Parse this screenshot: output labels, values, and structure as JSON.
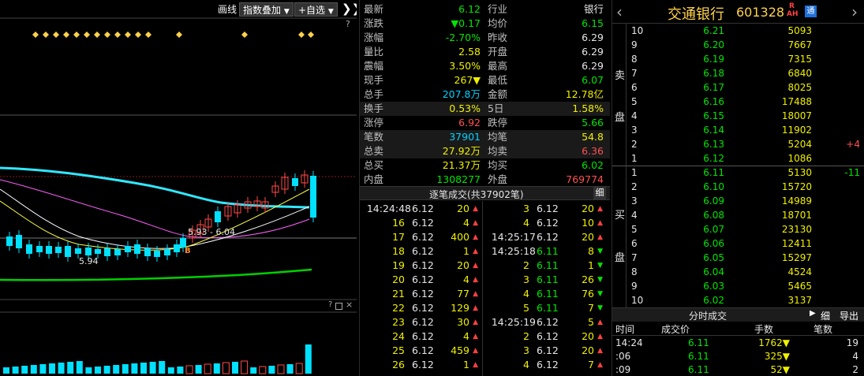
{
  "chart": {
    "draw_line_btn": "画线",
    "overlay_btn": "指数叠加",
    "watchlist_btn": "+自选",
    "help1": "?",
    "ma_label": "5.93 - 6.04",
    "low_label": "5.94",
    "b_marker": "B",
    "vol_help": "?"
  },
  "quote": {
    "rows": [
      {
        "l1": "最新",
        "v1": "6.12",
        "c1": "green",
        "l2": "行业",
        "v2": "银行",
        "c2": "white"
      },
      {
        "l1": "涨跌",
        "v1": "▼0.17",
        "c1": "green",
        "l2": "均价",
        "v2": "6.15",
        "c2": "green"
      },
      {
        "l1": "涨幅",
        "v1": "-2.70%",
        "c1": "green",
        "l2": "昨收",
        "v2": "6.29",
        "c2": "white"
      },
      {
        "l1": "量比",
        "v1": "2.58",
        "c1": "yellow",
        "l2": "开盘",
        "v2": "6.29",
        "c2": "white"
      },
      {
        "l1": "震幅",
        "v1": "3.50%",
        "c1": "yellow",
        "l2": "最高",
        "v2": "6.29",
        "c2": "white"
      },
      {
        "l1": "现手",
        "v1": "267▼",
        "c1": "yellow",
        "l2": "最低",
        "v2": "6.07",
        "c2": "green"
      },
      {
        "l1": "总手",
        "v1": "207.8万",
        "c1": "cyan",
        "l2": "金额",
        "v2": "12.78亿",
        "c2": "yellow"
      },
      {
        "l1": "换手",
        "v1": "0.53%",
        "c1": "yellow",
        "l2": "5日",
        "v2": "1.58%",
        "c2": "yellow"
      },
      {
        "l1": "涨停",
        "v1": "6.92",
        "c1": "red",
        "l2": "跌停",
        "v2": "5.66",
        "c2": "green"
      },
      {
        "l1": "笔数",
        "v1": "37901",
        "c1": "cyan",
        "l2": "均笔",
        "v2": "54.8",
        "c2": "yellow"
      },
      {
        "l1": "总卖",
        "v1": "27.92万",
        "c1": "yellow",
        "l2": "均卖",
        "v2": "6.36",
        "c2": "red"
      },
      {
        "l1": "总买",
        "v1": "21.37万",
        "c1": "yellow",
        "l2": "均买",
        "v2": "6.02",
        "c2": "green"
      },
      {
        "l1": "内盘",
        "v1": "1308277",
        "c1": "green",
        "l2": "外盘",
        "v2": "769774",
        "c2": "red"
      }
    ],
    "ticks_title": "逐笔成交(共37902笔)",
    "ticks_btn": "细",
    "ticks_left": [
      {
        "t": "14:24:48",
        "p": "6.12",
        "v": "20",
        "d": "up"
      },
      {
        "t": "16",
        "p": "6.12",
        "v": "4",
        "d": "up"
      },
      {
        "t": "17",
        "p": "6.12",
        "v": "400",
        "d": "up"
      },
      {
        "t": "18",
        "p": "6.12",
        "v": "1",
        "d": "up"
      },
      {
        "t": "19",
        "p": "6.12",
        "v": "20",
        "d": "up"
      },
      {
        "t": "20",
        "p": "6.12",
        "v": "4",
        "d": "up"
      },
      {
        "t": "21",
        "p": "6.12",
        "v": "77",
        "d": "up"
      },
      {
        "t": "22",
        "p": "6.12",
        "v": "129",
        "d": "up"
      },
      {
        "t": "23",
        "p": "6.12",
        "v": "30",
        "d": "up"
      },
      {
        "t": "24",
        "p": "6.12",
        "v": "4",
        "d": "up"
      },
      {
        "t": "25",
        "p": "6.12",
        "v": "459",
        "d": "up"
      },
      {
        "t": "26",
        "p": "6.12",
        "v": "1",
        "d": "up"
      }
    ],
    "ticks_right": [
      {
        "t": "3",
        "p": "6.12",
        "v": "20",
        "d": "up"
      },
      {
        "t": "4",
        "p": "6.12",
        "v": "10",
        "d": "up"
      },
      {
        "t": "14:25:17",
        "p": "6.12",
        "v": "20",
        "d": "up"
      },
      {
        "t": "14:25:18",
        "p": "6.11",
        "v": "8",
        "d": "down"
      },
      {
        "t": "2",
        "p": "6.11",
        "v": "1",
        "d": "down"
      },
      {
        "t": "3",
        "p": "6.11",
        "v": "26",
        "d": "down"
      },
      {
        "t": "4",
        "p": "6.11",
        "v": "76",
        "d": "down"
      },
      {
        "t": "5",
        "p": "6.11",
        "v": "7",
        "d": "down"
      },
      {
        "t": "14:25:19",
        "p": "6.12",
        "v": "5",
        "d": "up"
      },
      {
        "t": "2",
        "p": "6.12",
        "v": "20",
        "d": "up"
      },
      {
        "t": "3",
        "p": "6.12",
        "v": "20",
        "d": "up"
      },
      {
        "t": "4",
        "p": "6.12",
        "v": "7",
        "d": "up"
      }
    ]
  },
  "book": {
    "back_icon": "‹",
    "forward_icon": "›",
    "name": "交通银行",
    "code": "601328",
    "badge_r": "R",
    "badge_ah": "AH",
    "badge_tong": "通",
    "sell_label": [
      "卖",
      "盘"
    ],
    "buy_label": [
      "买",
      "盘"
    ],
    "asks": [
      {
        "lvl": "10",
        "price": "6.21",
        "vol": "5093",
        "chg": ""
      },
      {
        "lvl": "9",
        "price": "6.20",
        "vol": "7667",
        "chg": ""
      },
      {
        "lvl": "8",
        "price": "6.19",
        "vol": "7315",
        "chg": ""
      },
      {
        "lvl": "7",
        "price": "6.18",
        "vol": "6840",
        "chg": ""
      },
      {
        "lvl": "6",
        "price": "6.17",
        "vol": "8025",
        "chg": ""
      },
      {
        "lvl": "5",
        "price": "6.16",
        "vol": "17488",
        "chg": ""
      },
      {
        "lvl": "4",
        "price": "6.15",
        "vol": "18007",
        "chg": ""
      },
      {
        "lvl": "3",
        "price": "6.14",
        "vol": "11902",
        "chg": ""
      },
      {
        "lvl": "2",
        "price": "6.13",
        "vol": "5204",
        "chg": "+4"
      },
      {
        "lvl": "1",
        "price": "6.12",
        "vol": "1086",
        "chg": ""
      }
    ],
    "bids": [
      {
        "lvl": "1",
        "price": "6.11",
        "vol": "5130",
        "chg": "-11"
      },
      {
        "lvl": "2",
        "price": "6.10",
        "vol": "15720",
        "chg": ""
      },
      {
        "lvl": "3",
        "price": "6.09",
        "vol": "14989",
        "chg": ""
      },
      {
        "lvl": "4",
        "price": "6.08",
        "vol": "18701",
        "chg": ""
      },
      {
        "lvl": "5",
        "price": "6.07",
        "vol": "23130",
        "chg": ""
      },
      {
        "lvl": "6",
        "price": "6.06",
        "vol": "12411",
        "chg": ""
      },
      {
        "lvl": "7",
        "price": "6.05",
        "vol": "15297",
        "chg": ""
      },
      {
        "lvl": "8",
        "price": "6.04",
        "vol": "4524",
        "chg": ""
      },
      {
        "lvl": "9",
        "price": "6.03",
        "vol": "5465",
        "chg": ""
      },
      {
        "lvl": "10",
        "price": "6.02",
        "vol": "3137",
        "chg": ""
      }
    ],
    "minute_title": "分时成交",
    "minute_btn1": "细",
    "minute_btn2": "导出",
    "minute_headers": [
      "时间",
      "成交价",
      "手数",
      "笔数"
    ],
    "minute_rows": [
      {
        "t": "14:24",
        "p": "6.11",
        "v": "1762▼",
        "n": "19"
      },
      {
        "t": ":06",
        "p": "6.11",
        "v": "325▼",
        "n": "4"
      },
      {
        "t": ":09",
        "p": "6.11",
        "v": "52▼",
        "n": "2"
      }
    ]
  }
}
